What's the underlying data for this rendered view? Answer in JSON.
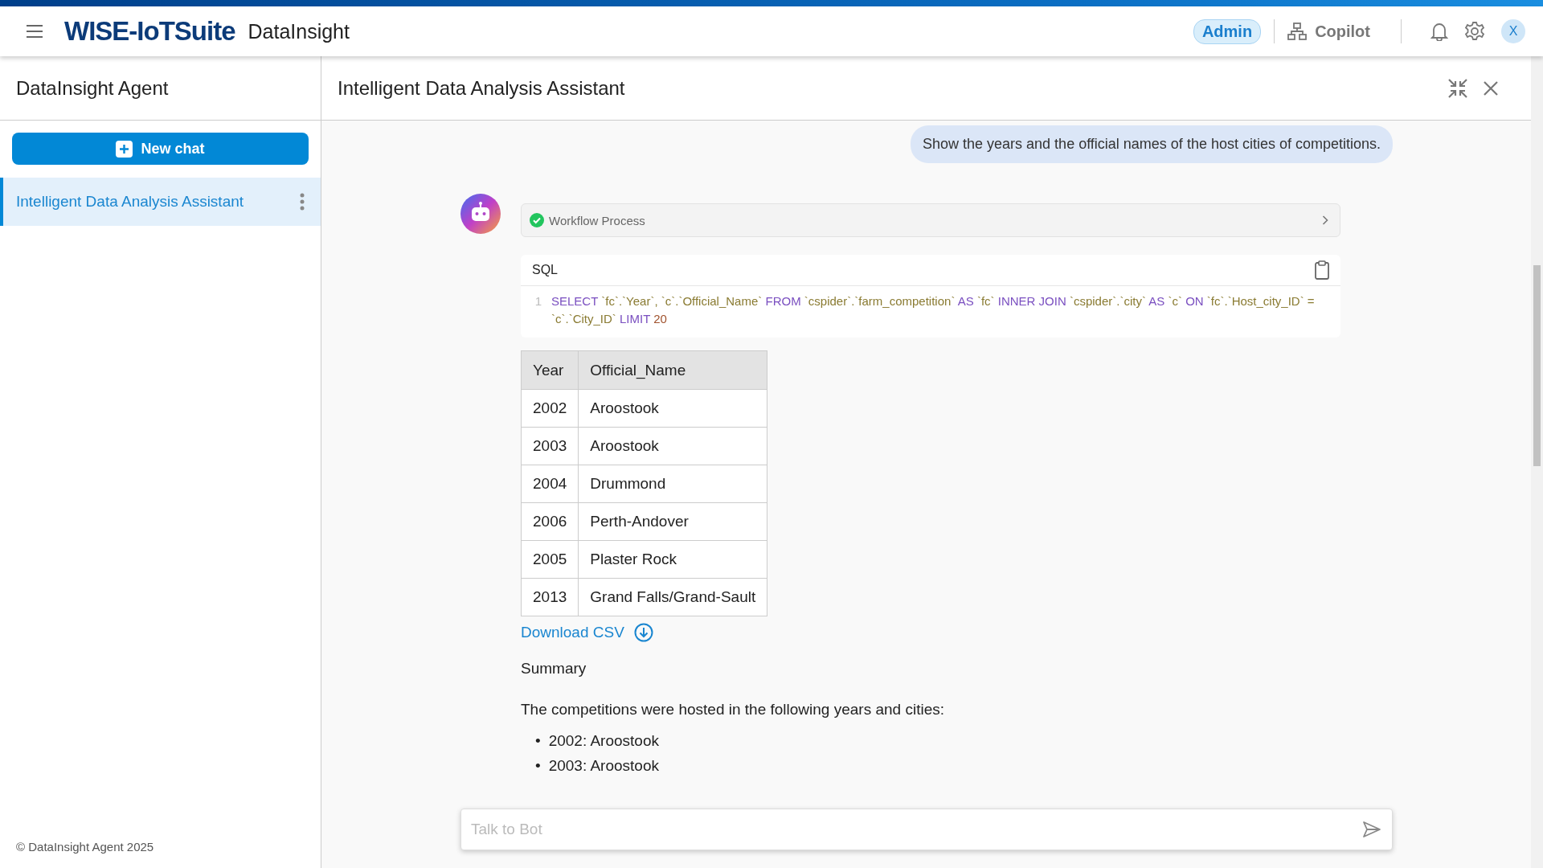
{
  "app": {
    "brand": "WISE-IoTSuite",
    "product": "DataInsight"
  },
  "topbar": {
    "role_badge": "Admin",
    "copilot": "Copilot",
    "avatar_initial": "X"
  },
  "sidebar": {
    "title": "DataInsight Agent",
    "new_chat": "New chat",
    "chats": [
      {
        "label": "Intelligent Data Analysis Assistant",
        "selected": true
      }
    ],
    "footer": "© DataInsight Agent 2025"
  },
  "chat": {
    "title": "Intelligent Data Analysis Assistant",
    "user_message": "Show the years and the official names of the host cities of competitions.",
    "workflow": {
      "label": "Workflow Process",
      "done": true
    },
    "sql": {
      "label": "SQL",
      "line_number": "1",
      "tokens": [
        {
          "text": "SELECT",
          "kind": "keyword"
        },
        {
          "text": "`fc`.`Year`, `c`.`Official_Name`",
          "kind": "identifier"
        },
        {
          "text": "FROM",
          "kind": "keyword"
        },
        {
          "text": "`cspider`.`farm_competition`",
          "kind": "identifier"
        },
        {
          "text": "AS",
          "kind": "keyword"
        },
        {
          "text": "`fc`",
          "kind": "identifier"
        },
        {
          "text": "INNER JOIN",
          "kind": "keyword"
        },
        {
          "text": "`cspider`.`city`",
          "kind": "identifier"
        },
        {
          "text": "AS",
          "kind": "keyword"
        },
        {
          "text": "`c`",
          "kind": "identifier"
        },
        {
          "text": "ON",
          "kind": "keyword"
        },
        {
          "text": "`fc`.`Host_city_ID` = `c`.`City_ID`",
          "kind": "identifier"
        },
        {
          "text": "LIMIT",
          "kind": "keyword"
        },
        {
          "text": "20",
          "kind": "number"
        }
      ]
    },
    "table": {
      "columns": [
        "Year",
        "Official_Name"
      ],
      "rows": [
        [
          "2002",
          "Aroostook"
        ],
        [
          "2003",
          "Aroostook"
        ],
        [
          "2004",
          "Drummond"
        ],
        [
          "2006",
          "Perth-Andover"
        ],
        [
          "2005",
          "Plaster Rock"
        ],
        [
          "2013",
          "Grand Falls/Grand-Sault"
        ]
      ]
    },
    "download": "Download CSV",
    "summary_title": "Summary",
    "summary_intro": "The competitions were hosted in the following years and cities:",
    "summary_items": [
      {
        "bullet": "•",
        "text": "2002: Aroostook"
      },
      {
        "bullet": "•",
        "text": "2003: Aroostook"
      }
    ],
    "input": {
      "placeholder": "Talk to Bot"
    }
  }
}
